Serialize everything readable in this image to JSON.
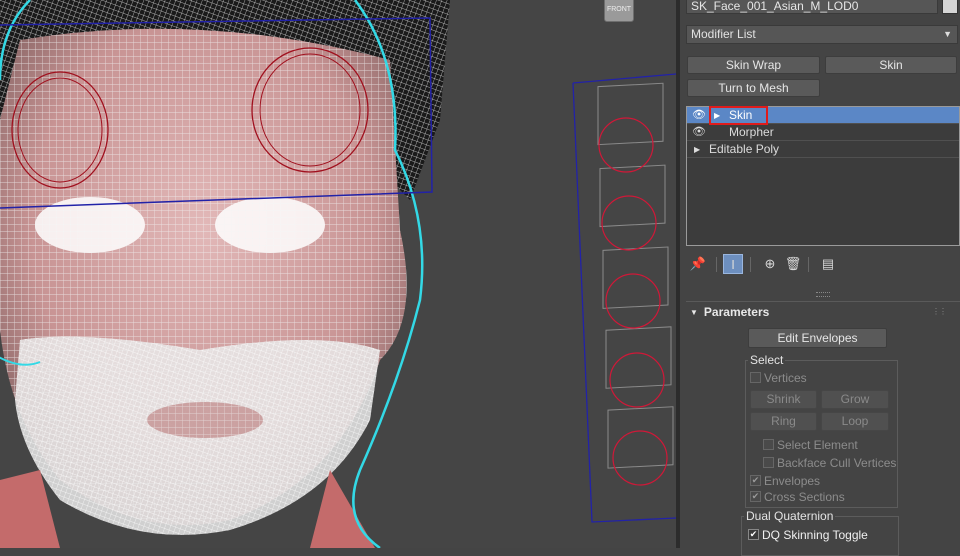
{
  "viewport": {
    "viewcube_label": "FRONT"
  },
  "panel": {
    "object_name": "SK_Face_001_Asian_M_LOD0",
    "modifier_list": "Modifier List",
    "buttons": {
      "skin_wrap": "Skin Wrap",
      "skin": "Skin",
      "turn_to_mesh": "Turn to Mesh"
    },
    "stack": [
      {
        "label": "Skin",
        "selected": true
      },
      {
        "label": "Morpher",
        "selected": false
      },
      {
        "label": "Editable Poly",
        "selected": false
      }
    ],
    "parameters": {
      "title": "Parameters",
      "edit_envelopes": "Edit Envelopes",
      "select_group": "Select",
      "vertices": "Vertices",
      "shrink": "Shrink",
      "grow": "Grow",
      "ring": "Ring",
      "loop": "Loop",
      "select_element": "Select Element",
      "backface_cull": "Backface Cull Vertices",
      "envelopes": "Envelopes",
      "cross_sections": "Cross Sections",
      "dual_quaternion": "Dual Quaternion",
      "dq_toggle": "DQ Skinning Toggle"
    }
  },
  "icons": {
    "pin": "pin-icon",
    "show_end_result": "show-end-result-icon",
    "make_unique": "make-unique-icon",
    "remove_modifier": "trash-icon",
    "configure_sets": "configure-sets-icon"
  },
  "colors": {
    "selection_blue": "#5b87c6",
    "highlight_red": "#e01b1b",
    "wire_white": "#f2f2f2",
    "skin_pink": "#d9a9a9",
    "outline_cyan": "#33d9e6"
  }
}
